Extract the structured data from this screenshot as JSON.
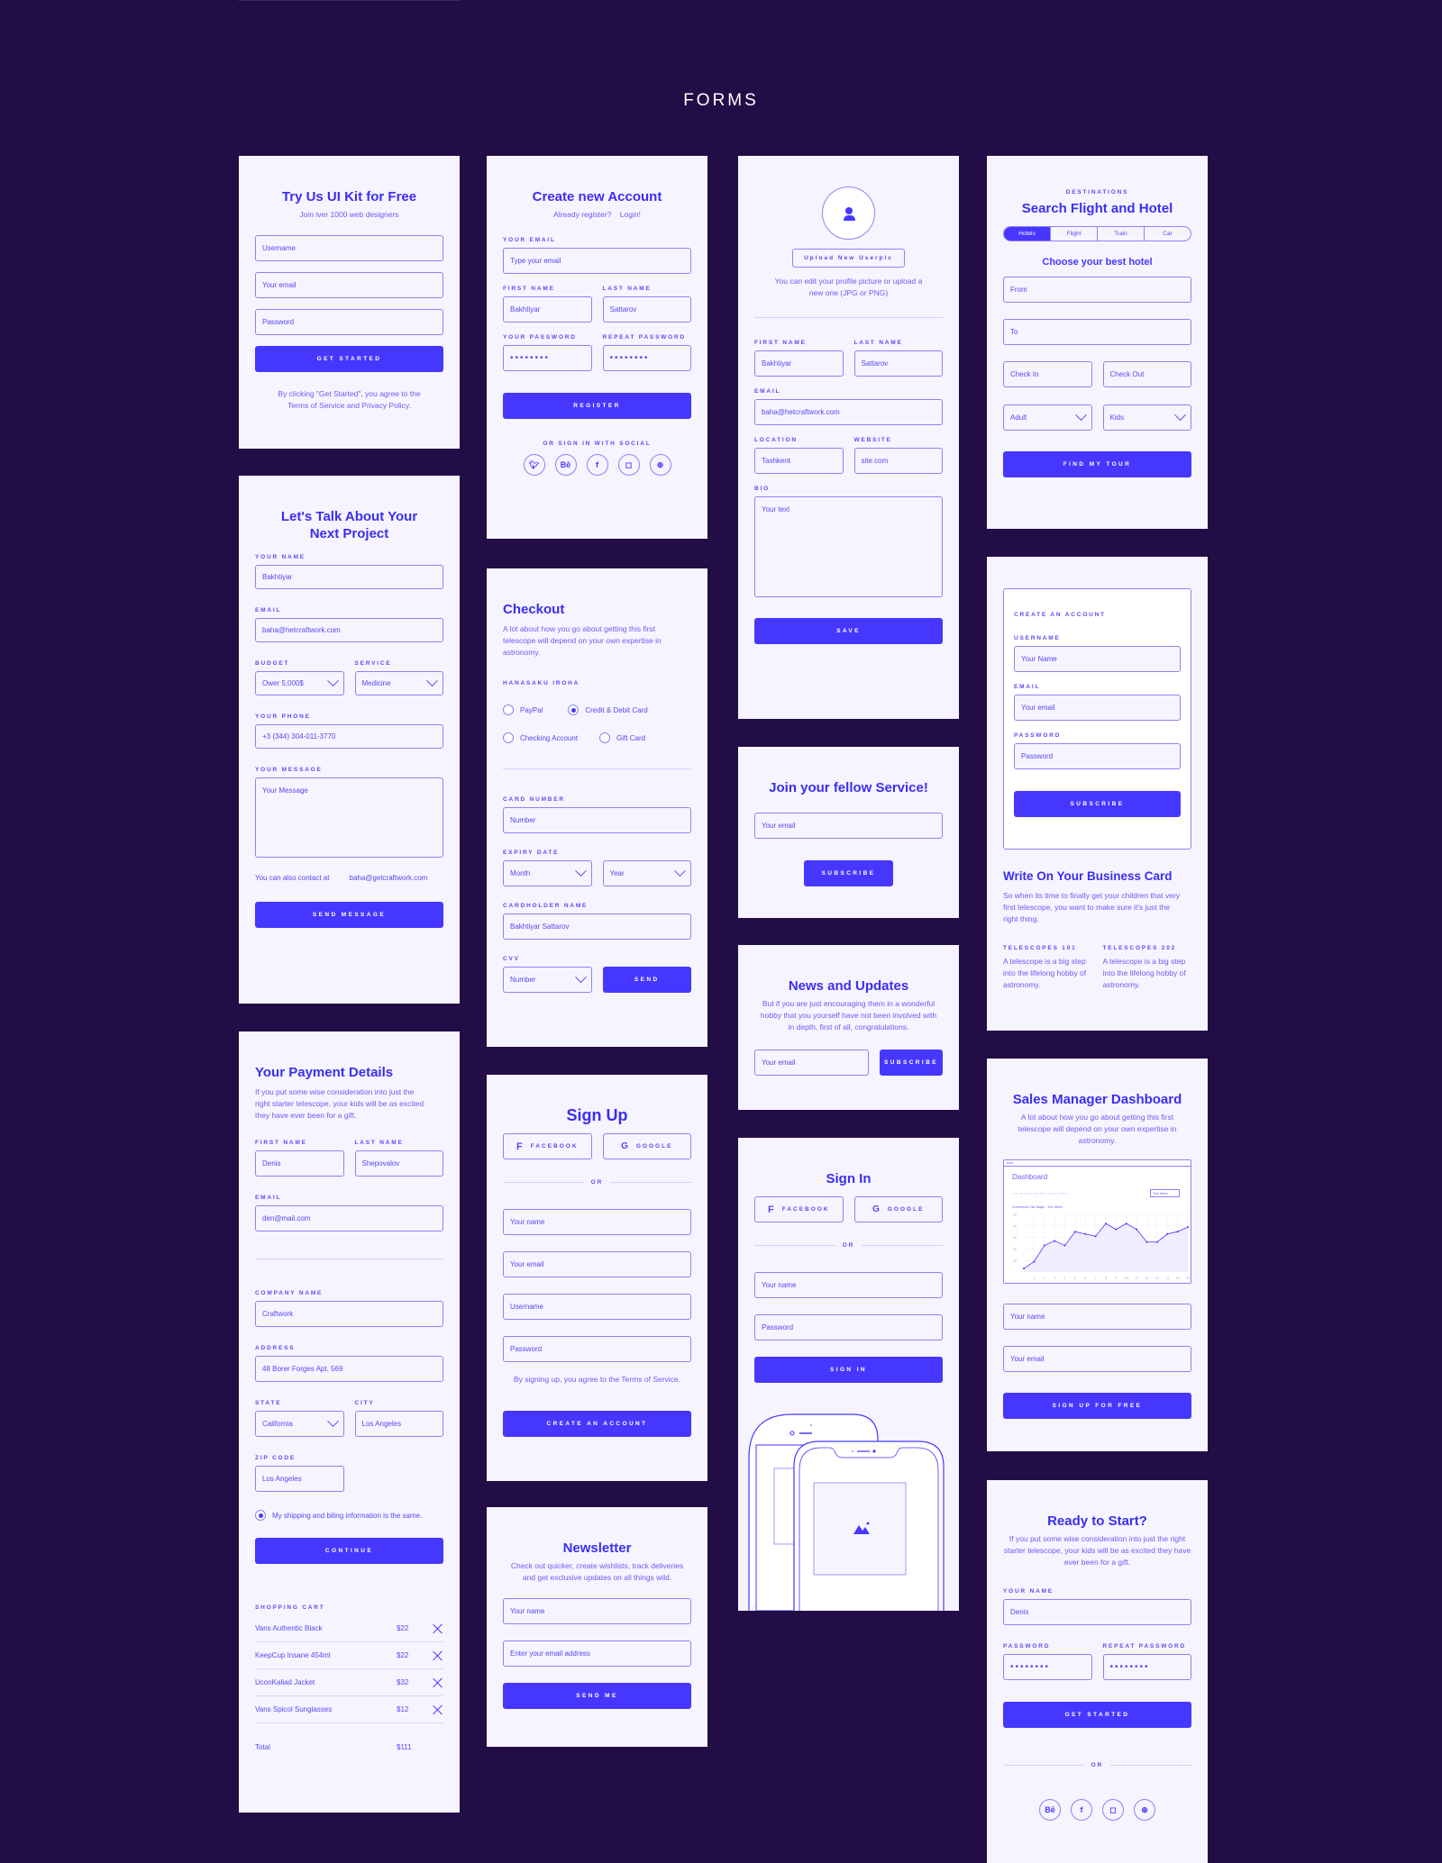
{
  "page": {
    "title": "FORMS"
  },
  "colors": {
    "background": "#230d47",
    "card": "#f6f4ff",
    "accent": "#4637ff",
    "border": "#8d82f5",
    "text": "#5548f2"
  },
  "try_kit": {
    "title": "Try Us UI Kit for Free",
    "subtitle": "Join iver 1000 web designers",
    "fields": [
      "Username",
      "Your email",
      "Password"
    ],
    "button": "Get Started",
    "terms": "By clicking \"Get Started\", you agree to the Terms of Service and Privacy Policy."
  },
  "create_account": {
    "title": "Create new Account",
    "already": "Already register?",
    "login": "Login!",
    "email_label": "Your Email",
    "email_placeholder": "Type your email",
    "first_label": "First Name",
    "first_value": "Bakhtiyar",
    "last_label": "Last Name",
    "last_value": "Sattarov",
    "pass_label": "Your Password",
    "pass_value": "••••••••",
    "repeat_label": "Repeat Password",
    "repeat_value": "••••••••",
    "button": "Register",
    "social_label": "Or sign in with social",
    "social": [
      "twitter",
      "behance",
      "facebook",
      "instagram",
      "dribbble"
    ]
  },
  "profile": {
    "upload": "Upload New Userpic",
    "hint": "You can edit your profile picture or upload a new one (JPG or PNG)",
    "first_label": "First Name",
    "first_value": "Bakhtiyar",
    "last_label": "Last Name",
    "last_value": "Sattarov",
    "email_label": "Email",
    "email_value": "baha@hetcraftwork.com",
    "location_label": "Location",
    "location_value": "Tashkent",
    "website_label": "Website",
    "website_value": "site.com",
    "bio_label": "Bio",
    "bio_placeholder": "Your text",
    "button": "Save"
  },
  "search": {
    "eyebrow": "Destinations",
    "title": "Search Flight and Hotel",
    "tabs": [
      "Hotels",
      "Flight",
      "Train",
      "Car"
    ],
    "active_tab": "Hotels",
    "subtitle": "Choose your best hotel",
    "from": "From",
    "to": "To",
    "check_in": "Check In",
    "check_out": "Check Out",
    "adult": "Adult",
    "kids": "Kids",
    "button": "Find My Tour"
  },
  "project": {
    "title": "Let's Talk About Your Next Project",
    "name_label": "Your Name",
    "name_value": "Bakhtiyar",
    "email_label": "Email",
    "email_value": "baha@hetcraftwork.com",
    "budget_label": "Budget",
    "budget_value": "Ower 5,000$",
    "service_label": "Service",
    "service_value": "Medicine",
    "phone_label": "Your Phone",
    "phone_value": "+3 (344) 304-011-3770",
    "message_label": "Your Message",
    "message_placeholder": "Your Message",
    "contact_text": "You can also contact at",
    "contact_email": "baha@getcraftwork.com",
    "button": "Send Message"
  },
  "checkout": {
    "title": "Checkout",
    "description": "A lot about how you go about getting this first telescope will depend on your own expertise in astronomy.",
    "section": "Hanasaku Iroha",
    "options": [
      "PayPal",
      "Credit & Debit Card",
      "Checking Account",
      "Gift Card"
    ],
    "selected": "Credit & Debit Card",
    "card_label": "Card Number",
    "card_placeholder": "Number",
    "expiry_label": "Expiry Date",
    "month": "Month",
    "year": "Year",
    "holder_label": "Cardholder Name",
    "holder_value": "Bakhtiyar Sattarov",
    "cvv_label": "CVV",
    "cvv_placeholder": "Number",
    "button": "Send"
  },
  "join": {
    "title": "Join your fellow Service!",
    "placeholder": "Your email",
    "button": "Subscribe"
  },
  "news": {
    "title": "News and Updates",
    "text": "But if you are just encouraging them in a wonderful hobby that you yourself have not been involved with in depth, first of all, congratulations.",
    "placeholder": "Your email",
    "button": "Subscribe"
  },
  "business": {
    "box_title": "Create an Account",
    "username_label": "Username",
    "username_placeholder": "Your Name",
    "email_label": "Email",
    "email_placeholder": "Your email",
    "password_label": "Password",
    "password_placeholder": "Password",
    "button": "Subscribe",
    "title": "Write On Your Business Card",
    "text": "So when its time to finally get your children that very first telescope, you want to make sure it's just the right thing.",
    "col1_title": "Telescopes 101",
    "col1_text": "A telescope is a big step into the lifelong hobby of astronomy.",
    "col2_title": "Telescopes 202",
    "col2_text": "A telescope is a big step into the lifelong hobby of astronomy."
  },
  "payment": {
    "title": "Your Payment Details",
    "description": "If you put some wise consideration into just the right starter telescope, your kids will be as excited they have ever been for a gift.",
    "first_label": "First Name",
    "first_value": "Denis",
    "last_label": "Last Name",
    "last_value": "Shepovalov",
    "email_label": "Email",
    "email_value": "den@mail.com",
    "company_label": "Company Name",
    "company_value": "Craftwork",
    "address_label": "Address",
    "address_value": "48 Borer Forges Apt. 569",
    "state_label": "State",
    "state_value": "California",
    "city_label": "City",
    "city_value": "Los Angeles",
    "zip_label": "Zip Code",
    "zip_value": "Los Angeles",
    "same_info": "My shipping and biling information is the same.",
    "button": "Continue",
    "cart_label": "Shopping Cart",
    "cart": [
      {
        "name": "Vans Authentic Black",
        "price": "$22"
      },
      {
        "name": "KeepCup Insane 454ml",
        "price": "$22"
      },
      {
        "name": "UconKaliad Jacket",
        "price": "$32"
      },
      {
        "name": "Vans Spicol Sunglasses",
        "price": "$12"
      }
    ],
    "total_label": "Total",
    "total_value": "$111"
  },
  "signup": {
    "title": "Sign Up",
    "facebook": "Facebook",
    "google": "Google",
    "or": "OR",
    "fields": [
      "Your name",
      "Your email",
      "Username",
      "Password"
    ],
    "terms": "By signing up, you agree to the Terms of Service.",
    "button": "Create an Account"
  },
  "newsletter": {
    "title": "Newsletter",
    "text": "Check out quicker, create wishlists, track deliveries and get exclusive updates on all things wild.",
    "name_placeholder": "Your name",
    "email_placeholder": "Enter your email address",
    "button": "Send Me"
  },
  "signin": {
    "title": "Sign In",
    "facebook": "Facebook",
    "google": "Google",
    "or": "OR",
    "name_placeholder": "Your name",
    "password_placeholder": "Password",
    "button": "Sign In"
  },
  "sales": {
    "title": "Sales Manager Dashboard",
    "text": "A lot about how you go about getting this first telescope will depend on your own expertise in astronomy.",
    "dashboard_title": "Dashboard",
    "dashboard_filter": "This Week",
    "dashboard_caption": "Conference Call Usage",
    "dashboard_caption_period": "This Week",
    "name_placeholder": "Your name",
    "email_placeholder": "Your email",
    "button": "Sign Up For Free"
  },
  "chart_data": {
    "type": "area",
    "title": "Conference Call Usage",
    "x": [
      0,
      1,
      2,
      3,
      4,
      5,
      6,
      7,
      8,
      9,
      10,
      11,
      12,
      13,
      14,
      15,
      16
    ],
    "x_ticks": [
      "1",
      "2",
      "3",
      "4",
      "5",
      "6",
      "7",
      "8",
      "9",
      "10",
      "11",
      "12",
      "13",
      "14",
      "15",
      "16"
    ],
    "values": [
      3,
      9,
      23,
      27,
      23,
      35,
      33,
      31,
      42,
      37,
      42,
      37,
      26,
      26,
      33,
      35,
      39
    ],
    "y_ticks": [
      10,
      20,
      30,
      40,
      50
    ],
    "ylim": [
      0,
      50
    ],
    "grid": true
  },
  "ready": {
    "title": "Ready to Start?",
    "text": "If you put some wise consideration into just the right starter telescope, your kids will be as excited they have ever been for a gift.",
    "name_label": "Your Name",
    "name_value": "Denis",
    "pass_label": "Password",
    "pass_value": "••••••••",
    "repeat_label": "Repeat Password",
    "repeat_value": "••••••••",
    "button": "Get Started",
    "or": "OR",
    "social": [
      "behance",
      "facebook",
      "instagram",
      "dribbble"
    ]
  }
}
